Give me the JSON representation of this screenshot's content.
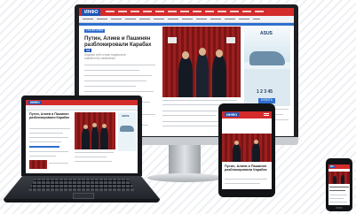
{
  "brand": {
    "logo_desktop": "ИНФО",
    "logo_laptop": "ИНФО",
    "logo_tablet": "ИНФО",
    "logo_phone": "ИН"
  },
  "desktop": {
    "section_label": "ПОЛИТИКА",
    "headline": "Путин, Алиев и Пашинян разблокировали Карабах",
    "headline_badge": "14",
    "sub_line1": "Лидеры трёх стран подписали",
    "sub_line2": "совместное заявление",
    "ad_brand": "ASUS",
    "ad_price": "1 2 3 45",
    "ad_button": "КУПИТЬ"
  },
  "laptop": {
    "headline": "Путин, Алиев и Пашинян разблокировали Карабах",
    "ad_brand": "ASUS"
  },
  "tablet": {
    "headline": "Путин, Алиев и Пашинян разблокировали Карабах"
  },
  "colors": {
    "accent": "#d42b2b",
    "brand_blue": "#1e56b3"
  }
}
